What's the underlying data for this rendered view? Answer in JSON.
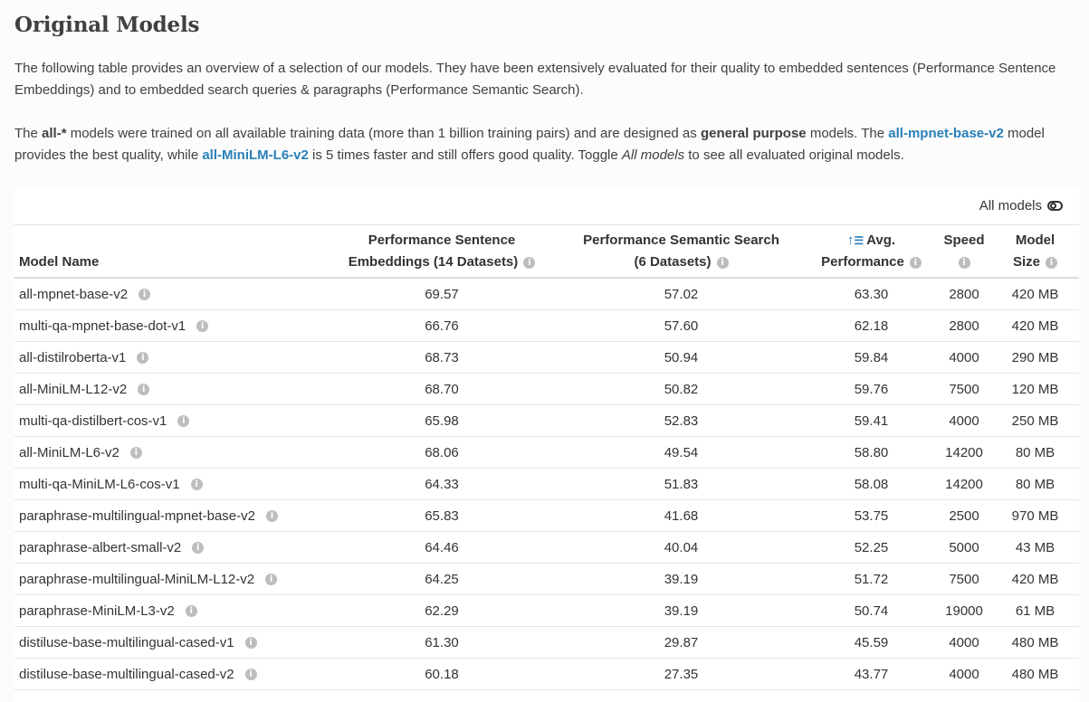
{
  "title": "Original Models",
  "intro": {
    "p1": "The following table provides an overview of a selection of our models. They have been extensively evaluated for their quality to embedded sentences (Performance Sentence Embeddings) and to embedded search queries & paragraphs (Performance Semantic Search).",
    "p2_a": "The ",
    "p2_b": "all-*",
    "p2_c": " models were trained on all available training data (more than 1 billion training pairs) and are designed as ",
    "p2_d": "general purpose",
    "p2_e": " models. The ",
    "p2_link1": "all-mpnet-base-v2",
    "p2_f": " model provides the best quality, while ",
    "p2_link2": "all-MiniLM-L6-v2",
    "p2_g": " is 5 times faster and still offers good quality. Toggle ",
    "p2_h": "All models",
    "p2_i": " to see all evaluated original models."
  },
  "toggle_label": "All models",
  "headers": {
    "name": "Model Name",
    "sent_l1": "Performance Sentence",
    "sent_l2": "Embeddings (14 Datasets)",
    "search_l1": "Performance Semantic Search",
    "search_l2": "(6 Datasets)",
    "avg_l1": "Avg.",
    "avg_l2": "Performance",
    "speed": "Speed",
    "size_l1": "Model",
    "size_l2": "Size"
  },
  "info_glyph": "i",
  "sort_icon": "sort-ascending-icon",
  "rows": [
    {
      "name": "all-mpnet-base-v2",
      "sent": "69.57",
      "search": "57.02",
      "avg": "63.30",
      "speed": "2800",
      "size": "420 MB"
    },
    {
      "name": "multi-qa-mpnet-base-dot-v1",
      "sent": "66.76",
      "search": "57.60",
      "avg": "62.18",
      "speed": "2800",
      "size": "420 MB"
    },
    {
      "name": "all-distilroberta-v1",
      "sent": "68.73",
      "search": "50.94",
      "avg": "59.84",
      "speed": "4000",
      "size": "290 MB"
    },
    {
      "name": "all-MiniLM-L12-v2",
      "sent": "68.70",
      "search": "50.82",
      "avg": "59.76",
      "speed": "7500",
      "size": "120 MB"
    },
    {
      "name": "multi-qa-distilbert-cos-v1",
      "sent": "65.98",
      "search": "52.83",
      "avg": "59.41",
      "speed": "4000",
      "size": "250 MB"
    },
    {
      "name": "all-MiniLM-L6-v2",
      "sent": "68.06",
      "search": "49.54",
      "avg": "58.80",
      "speed": "14200",
      "size": "80 MB"
    },
    {
      "name": "multi-qa-MiniLM-L6-cos-v1",
      "sent": "64.33",
      "search": "51.83",
      "avg": "58.08",
      "speed": "14200",
      "size": "80 MB"
    },
    {
      "name": "paraphrase-multilingual-mpnet-base-v2",
      "sent": "65.83",
      "search": "41.68",
      "avg": "53.75",
      "speed": "2500",
      "size": "970 MB"
    },
    {
      "name": "paraphrase-albert-small-v2",
      "sent": "64.46",
      "search": "40.04",
      "avg": "52.25",
      "speed": "5000",
      "size": "43 MB"
    },
    {
      "name": "paraphrase-multilingual-MiniLM-L12-v2",
      "sent": "64.25",
      "search": "39.19",
      "avg": "51.72",
      "speed": "7500",
      "size": "420 MB"
    },
    {
      "name": "paraphrase-MiniLM-L3-v2",
      "sent": "62.29",
      "search": "39.19",
      "avg": "50.74",
      "speed": "19000",
      "size": "61 MB"
    },
    {
      "name": "distiluse-base-multilingual-cased-v1",
      "sent": "61.30",
      "search": "29.87",
      "avg": "45.59",
      "speed": "4000",
      "size": "480 MB"
    },
    {
      "name": "distiluse-base-multilingual-cased-v2",
      "sent": "60.18",
      "search": "27.35",
      "avg": "43.77",
      "speed": "4000",
      "size": "480 MB"
    }
  ]
}
